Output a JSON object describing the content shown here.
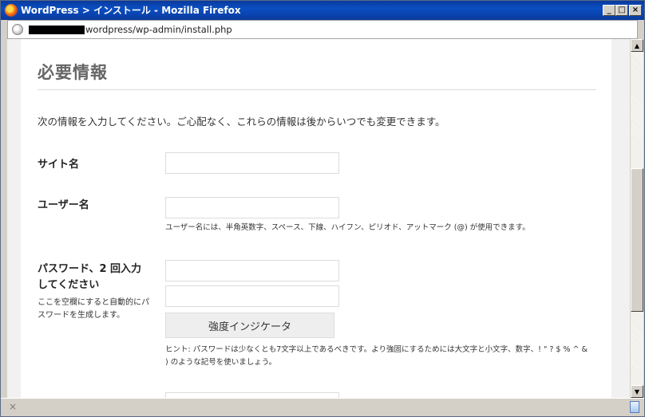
{
  "window": {
    "title": "WordPress > インストール - Mozilla Firefox",
    "minimize_label": "_",
    "maximize_label": "□",
    "close_label": "×"
  },
  "urlbar": {
    "url": "wordpress/wp-admin/install.php"
  },
  "page": {
    "heading": "必要情報",
    "intro": "次の情報を入力してください。ご心配なく、これらの情報は後からいつでも変更できます。",
    "site_label": "サイト名",
    "site_value": "",
    "user_label": "ユーザー名",
    "user_value": "",
    "user_hint": "ユーザー名には、半角英数字、スペース、下線、ハイフン、ピリオド、アットマーク (@) が使用できます。",
    "pass_label": "パスワード、2 回入力してください",
    "pass_note": "ここを空欄にすると自動的にパスワードを生成します。",
    "strength_label": "強度インジケータ",
    "pass_hint": "ヒント: パスワードは少なくとも7文字以上であるべきです。より強固にするためには大文字と小文字、数字、! \" ? $ % ^ & ) のような記号を使いましょう。"
  },
  "scrollbar": {
    "up_arrow": "▲",
    "down_arrow": "▼"
  },
  "statusbar": {
    "close_glyph": "×"
  }
}
